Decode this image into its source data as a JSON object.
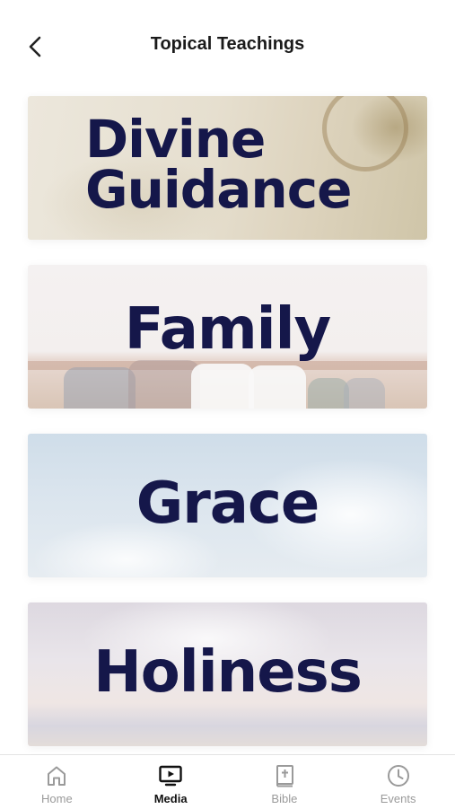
{
  "header": {
    "title": "Topical Teachings",
    "back_icon": "chevron-left-icon"
  },
  "cards": [
    {
      "line1": "Divine",
      "line2": "Guidance"
    },
    {
      "label": "Family"
    },
    {
      "label": "Grace"
    },
    {
      "label": "Holiness"
    }
  ],
  "tabbar": {
    "tabs": [
      {
        "label": "Home",
        "icon": "home-icon",
        "active": false
      },
      {
        "label": "Media",
        "icon": "tv-play-icon",
        "active": true
      },
      {
        "label": "Bible",
        "icon": "bible-icon",
        "active": false
      },
      {
        "label": "Events",
        "icon": "clock-icon",
        "active": false
      }
    ],
    "active_color": "#111111",
    "inactive_color": "#9a9a9a"
  },
  "colors": {
    "card_text": "#15174a"
  }
}
